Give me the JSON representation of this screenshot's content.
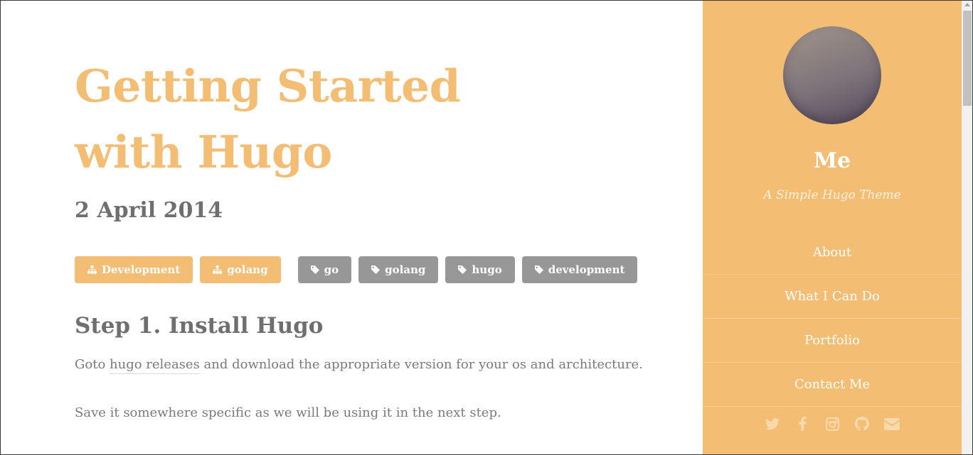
{
  "post": {
    "title": "Getting Started with Hugo",
    "date": "2 April 2014",
    "categories": [
      {
        "label": "Development",
        "icon": "sitemap-icon"
      },
      {
        "label": "golang",
        "icon": "sitemap-icon"
      }
    ],
    "tags": [
      {
        "label": "go",
        "icon": "tag-icon"
      },
      {
        "label": "golang",
        "icon": "tag-icon"
      },
      {
        "label": "hugo",
        "icon": "tag-icon"
      },
      {
        "label": "development",
        "icon": "tag-icon"
      }
    ],
    "section_heading": "Step 1. Install Hugo",
    "para1": {
      "before": "Goto ",
      "link": "hugo releases",
      "after": " and download the appropriate version for your os and architecture."
    },
    "para2": "Save it somewhere specific as we will be using it in the next step."
  },
  "sidebar": {
    "name": "Me",
    "tagline": "A Simple Hugo Theme",
    "nav": [
      {
        "label": "About"
      },
      {
        "label": "What I Can Do"
      },
      {
        "label": "Portfolio"
      },
      {
        "label": "Contact Me"
      }
    ],
    "social": [
      "twitter-icon",
      "facebook-icon",
      "instagram-icon",
      "github-icon",
      "email-icon"
    ]
  },
  "colors": {
    "accent": "#f3bd74",
    "tag_gray": "#979797",
    "text_gray": "#6f6f6f",
    "sidebar_bg": "#f3be74",
    "social_icon": "#f8d8a8"
  }
}
